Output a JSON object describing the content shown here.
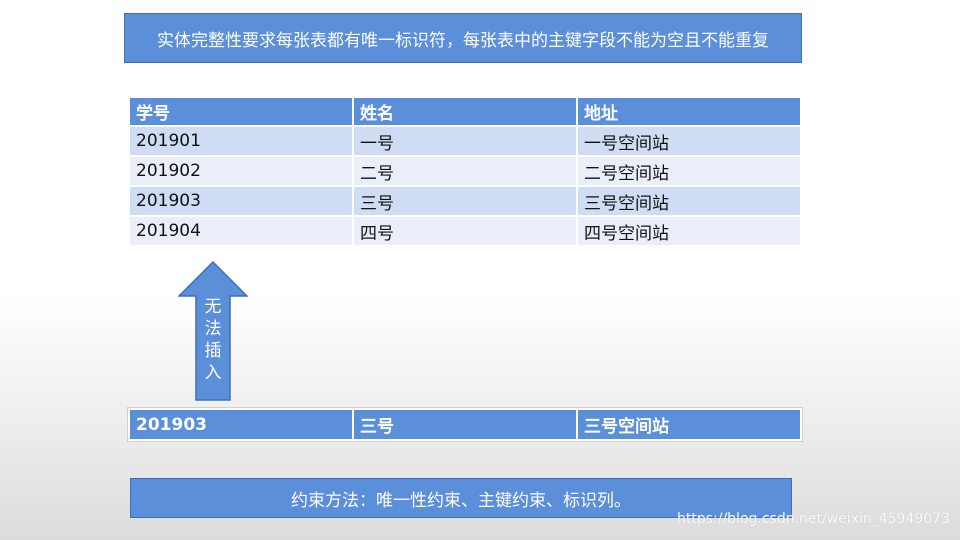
{
  "title": "实体完整性要求每张表都有唯一标识符，每张表中的主键字段不能为空且不能重复",
  "table": {
    "headers": [
      "学号",
      "姓名",
      "地址"
    ],
    "rows": [
      [
        "201901",
        "一号",
        "一号空间站"
      ],
      [
        "201902",
        "二号",
        "二号空间站"
      ],
      [
        "201903",
        "三号",
        "三号空间站"
      ],
      [
        "201904",
        "四号",
        "四号空间站"
      ]
    ]
  },
  "arrow": {
    "chars": [
      "无",
      "法",
      "插",
      "入"
    ],
    "icon": "up-arrow-icon",
    "color": "#5b8fd9"
  },
  "insert_row": [
    "201903",
    "三号",
    "三号空间站"
  ],
  "footer": "约束方法：唯一性约束、主键约束、标识列。",
  "watermark": "https://blog.csdn.net/weixin_45949073",
  "colors": {
    "accent": "#5b8fd9",
    "row_odd": "#d0dcf3",
    "row_even": "#e9eef8"
  }
}
